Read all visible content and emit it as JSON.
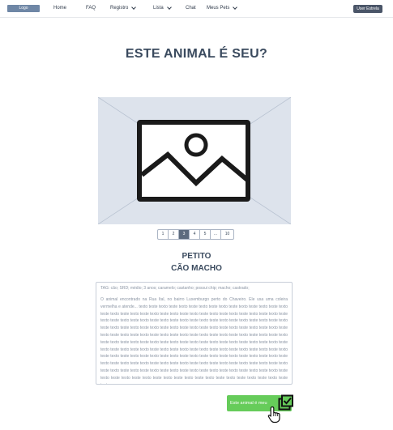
{
  "navbar": {
    "logo": "Logo",
    "items": [
      {
        "label": "Home",
        "dropdown": false
      },
      {
        "label": "FAQ",
        "dropdown": false
      },
      {
        "label": "Registro",
        "dropdown": true
      },
      {
        "label": "Lista",
        "dropdown": true
      },
      {
        "label": "Chat",
        "dropdown": false
      },
      {
        "label": "Meus Pets",
        "dropdown": true
      }
    ],
    "user_button": "User Estrela"
  },
  "page": {
    "title": "ESTE ANIMAL É SEU?"
  },
  "gallery": {
    "image_icon": "image-placeholder-icon",
    "pages": [
      "1",
      "2",
      "3",
      "4",
      "5",
      "...",
      "10"
    ],
    "active_page": "3"
  },
  "pet": {
    "name": "PETITO",
    "type": "CÃO MACHO"
  },
  "description": {
    "tags": "TAG: cão; SRD; médio; 3 anos; caramelo; castanho; possui chip; macho; castrado;",
    "body": "O animal encontrado na Rua Ital, no bairro Luxemburgo perto do Chaveiro. Ele usa uma coleira vermelha e atende... texto teste texto teste texto teste texto teste texto teste texto teste texto teste texto teste texto teste texto teste texto teste texto teste texto teste texto teste texto teste texto teste texto teste texto teste texto teste texto teste texto teste texto teste texto teste texto teste texto teste texto teste texto teste texto teste texto teste texto teste texto teste texto teste texto teste texto teste texto teste texto teste texto teste texto teste texto teste texto teste texto teste texto teste texto teste texto teste texto teste texto teste texto teste texto teste texto teste texto teste texto teste texto teste texto teste texto teste texto teste texto teste texto teste texto teste texto teste texto teste texto teste texto teste texto teste texto teste texto teste texto teste texto teste texto teste texto teste texto teste texto teste texto teste texto teste texto teste texto teste texto teste texto teste texto teste texto teste texto teste texto teste texto teste texto teste texto teste texto teste texto teste texto teste texto teste texto teste texto teste texto teste texto teste texto teste texto teste texto teste texto teste texto teste texto teste texto teste texto teste texto teste texto teste texto..."
  },
  "actions": {
    "claim_label": "Este animal é meu",
    "claim_icon": "checklist-icon",
    "cursor_icon": "hand-pointer-icon"
  },
  "colors": {
    "accent_green": "#66cc5a",
    "logo_blue": "#6f87a6",
    "user_button": "#4a5568",
    "image_bg": "#dde3ec",
    "active_page": "#5d6b7e"
  }
}
